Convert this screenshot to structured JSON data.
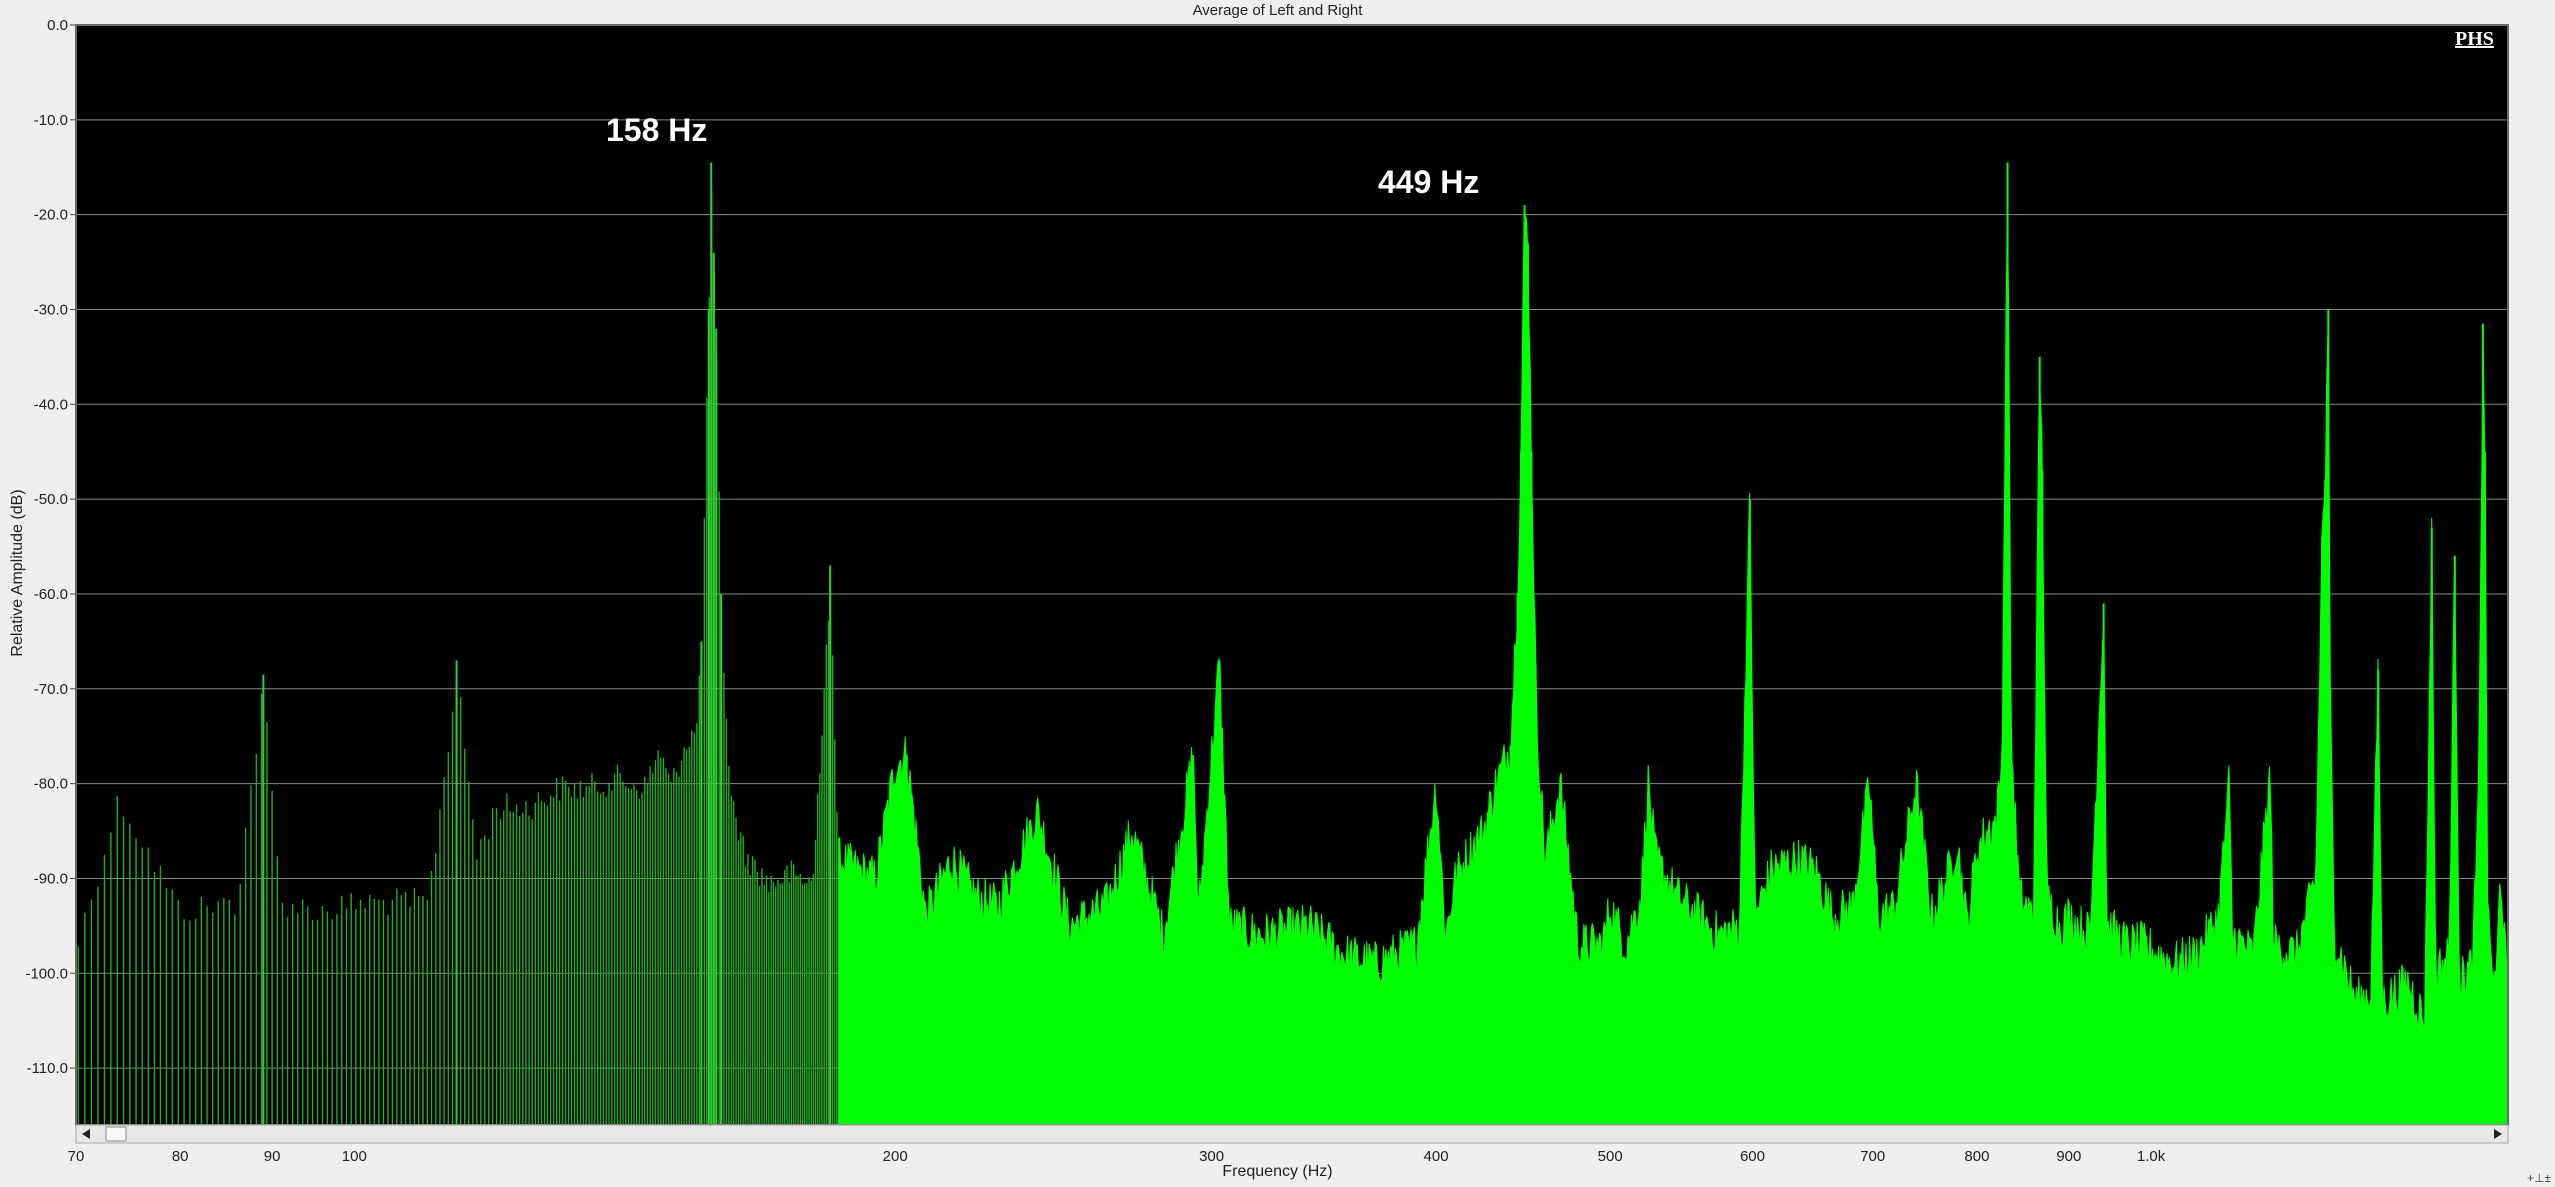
{
  "chart_data": {
    "type": "area",
    "title": "Average of Left and Right",
    "xlabel": "Frequency (Hz)",
    "ylabel": "Relative Amplitude (dB)",
    "x_scale": "log",
    "xlim": [
      70,
      1580
    ],
    "ylim": [
      -116,
      0
    ],
    "y_ticks": [
      "0.0",
      "-10.0",
      "-20.0",
      "-30.0",
      "-40.0",
      "-50.0",
      "-60.0",
      "-70.0",
      "-80.0",
      "-90.0",
      "-100.0",
      "-110.0"
    ],
    "x_ticks": [
      "70",
      "80",
      "90",
      "100",
      "200",
      "300",
      "400",
      "500",
      "600",
      "700",
      "800",
      "900",
      "1.0k"
    ],
    "grid": true,
    "series": [
      {
        "color": "#00ff00",
        "points": [
          [
            70,
            -96
          ],
          [
            74,
            -80
          ],
          [
            80,
            -92
          ],
          [
            86,
            -91
          ],
          [
            89,
            -68.5
          ],
          [
            91,
            -91
          ],
          [
            96,
            -92
          ],
          [
            101,
            -91
          ],
          [
            110,
            -91
          ],
          [
            114,
            -67
          ],
          [
            117,
            -86
          ],
          [
            120,
            -81
          ],
          [
            125,
            -81
          ],
          [
            130,
            -79
          ],
          [
            135,
            -79
          ],
          [
            140,
            -78
          ],
          [
            145,
            -79
          ],
          [
            148,
            -75
          ],
          [
            150,
            -79
          ],
          [
            153,
            -74
          ],
          [
            155,
            -73
          ],
          [
            156,
            -65
          ],
          [
            157.5,
            -30
          ],
          [
            158,
            -14.5
          ],
          [
            158.5,
            -24
          ],
          [
            159,
            -32
          ],
          [
            160,
            -60
          ],
          [
            162,
            -80
          ],
          [
            165,
            -86
          ],
          [
            170,
            -89
          ],
          [
            175,
            -88
          ],
          [
            180,
            -89
          ],
          [
            184,
            -57
          ],
          [
            186,
            -88
          ],
          [
            190,
            -89
          ],
          [
            195,
            -90
          ],
          [
            200,
            -78
          ],
          [
            203,
            -77
          ],
          [
            208,
            -94
          ],
          [
            215,
            -88
          ],
          [
            222,
            -92
          ],
          [
            228,
            -93
          ],
          [
            240,
            -83
          ],
          [
            250,
            -95
          ],
          [
            262,
            -93
          ],
          [
            271,
            -85
          ],
          [
            282,
            -96
          ],
          [
            293,
            -77
          ],
          [
            295,
            -94
          ],
          [
            303,
            -67
          ],
          [
            307,
            -95
          ],
          [
            320,
            -96
          ],
          [
            340,
            -95
          ],
          [
            355,
            -98
          ],
          [
            370,
            -99
          ],
          [
            380,
            -98
          ],
          [
            390,
            -97
          ],
          [
            400,
            -80
          ],
          [
            405,
            -96
          ],
          [
            410,
            -90
          ],
          [
            418,
            -87
          ],
          [
            425,
            -85
          ],
          [
            432,
            -80
          ],
          [
            440,
            -76
          ],
          [
            444,
            -60
          ],
          [
            446,
            -45
          ],
          [
            448,
            -19
          ],
          [
            450,
            -23
          ],
          [
            452,
            -45
          ],
          [
            455,
            -73
          ],
          [
            460,
            -88
          ],
          [
            469,
            -80
          ],
          [
            480,
            -97
          ],
          [
            495,
            -97
          ],
          [
            500,
            -93
          ],
          [
            510,
            -97
          ],
          [
            520,
            -92
          ],
          [
            525,
            -80
          ],
          [
            530,
            -88
          ],
          [
            545,
            -92
          ],
          [
            560,
            -94
          ],
          [
            575,
            -96
          ],
          [
            590,
            -95
          ],
          [
            598,
            -50
          ],
          [
            602,
            -94
          ],
          [
            615,
            -89
          ],
          [
            635,
            -88
          ],
          [
            650,
            -89
          ],
          [
            665,
            -94
          ],
          [
            682,
            -93
          ],
          [
            697,
            -80
          ],
          [
            705,
            -94
          ],
          [
            720,
            -93
          ],
          [
            740,
            -80
          ],
          [
            755,
            -94
          ],
          [
            770,
            -90
          ],
          [
            780,
            -86
          ],
          [
            790,
            -95
          ],
          [
            800,
            -87
          ],
          [
            810,
            -85
          ],
          [
            820,
            -84
          ],
          [
            826,
            -78
          ],
          [
            832,
            -14.5
          ],
          [
            836,
            -76
          ],
          [
            845,
            -92
          ],
          [
            860,
            -94
          ],
          [
            867,
            -35
          ],
          [
            870,
            -47
          ],
          [
            875,
            -92
          ],
          [
            890,
            -95
          ],
          [
            900,
            -94
          ],
          [
            925,
            -96
          ],
          [
            941,
            -61
          ],
          [
            945,
            -95
          ],
          [
            970,
            -97
          ],
          [
            990,
            -97
          ],
          [
            1010,
            -98
          ],
          [
            1030,
            -99
          ],
          [
            1060,
            -98
          ],
          [
            1090,
            -94
          ],
          [
            1105,
            -80
          ],
          [
            1110,
            -96
          ],
          [
            1140,
            -98
          ],
          [
            1165,
            -79
          ],
          [
            1170,
            -97
          ],
          [
            1205,
            -98
          ],
          [
            1235,
            -90
          ],
          [
            1245,
            -54
          ],
          [
            1250,
            -48
          ],
          [
            1255,
            -30
          ],
          [
            1258,
            -70
          ],
          [
            1265,
            -96
          ],
          [
            1300,
            -103
          ],
          [
            1325,
            -102
          ],
          [
            1338,
            -68
          ],
          [
            1345,
            -103
          ],
          [
            1390,
            -101
          ],
          [
            1420,
            -105
          ],
          [
            1433,
            -53
          ],
          [
            1440,
            -100
          ],
          [
            1465,
            -98
          ],
          [
            1476,
            -56
          ],
          [
            1485,
            -101
          ],
          [
            1510,
            -99
          ],
          [
            1522,
            -80
          ],
          [
            1530,
            -31.5
          ],
          [
            1534,
            -45
          ],
          [
            1540,
            -95
          ],
          [
            1555,
            -102
          ],
          [
            1565,
            -89
          ],
          [
            1580,
            -103
          ]
        ]
      }
    ],
    "annotations": [
      {
        "x": 158,
        "y": -14.5,
        "text": "158 Hz"
      },
      {
        "x": 449,
        "y": -19,
        "text": "449 Hz"
      }
    ]
  },
  "watermark": "PHS"
}
